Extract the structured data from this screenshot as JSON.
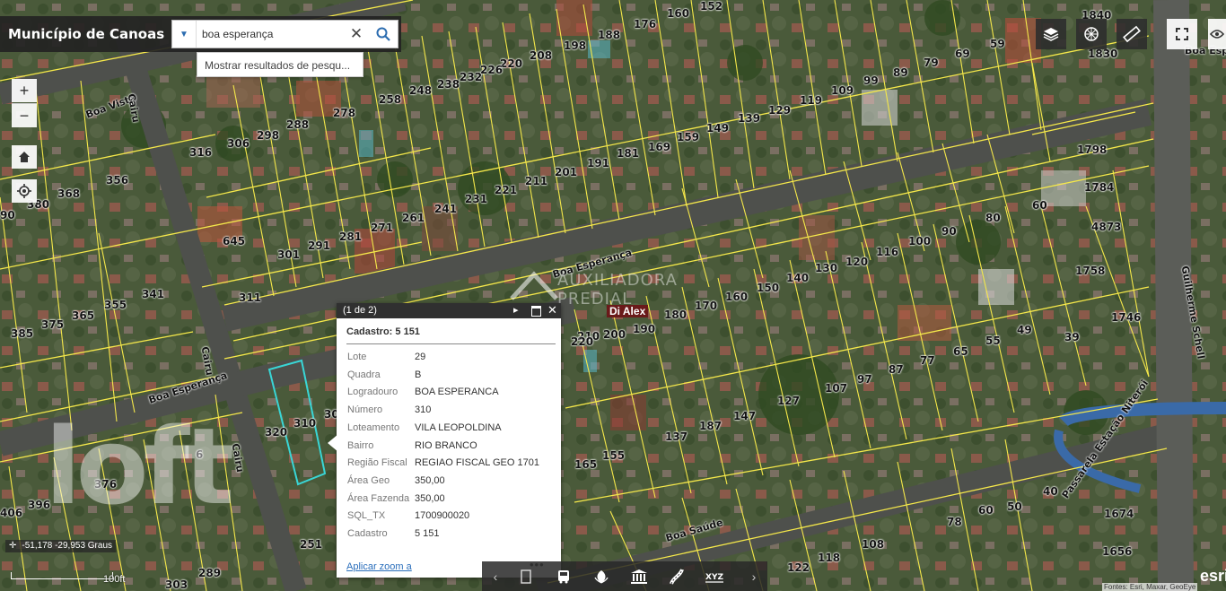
{
  "app": {
    "title": "Município de Canoas"
  },
  "search": {
    "value": "boa esperança",
    "suggestion": "Mostrar resultados de pesqu..."
  },
  "popup": {
    "count": "(1 de 2)",
    "title": "Cadastro: 5 151",
    "fields": [
      {
        "key": "Lote",
        "value": "29"
      },
      {
        "key": "Quadra",
        "value": "B"
      },
      {
        "key": "Logradouro",
        "value": "BOA ESPERANCA"
      },
      {
        "key": "Número",
        "value": "310"
      },
      {
        "key": "Loteamento",
        "value": "VILA LEOPOLDINA"
      },
      {
        "key": "Bairro",
        "value": "RIO BRANCO"
      },
      {
        "key": "Região Fiscal",
        "value": "REGIAO FISCAL GEO 1701"
      },
      {
        "key": "Área Geo",
        "value": "350,00"
      },
      {
        "key": "Área Fazenda",
        "value": "350,00"
      },
      {
        "key": "SQL_TX",
        "value": "1700900020"
      },
      {
        "key": "Cadastro",
        "value": "5 151"
      }
    ],
    "zoom_link": "Aplicar zoom a",
    "more": "•••"
  },
  "status": {
    "coordinates": "-51,178 -29,953 Graus",
    "scale": "100ft"
  },
  "streets": [
    "Boa Vista",
    "Cairu",
    "Boa Esperança",
    "Boa Esperança",
    "Cairu",
    "Boa Esperança",
    "Cairu",
    "Boa Saúde",
    "Guilherme Schell",
    "Passarela Estação Niterói"
  ],
  "parcels": [
    "176",
    "160",
    "152",
    "198",
    "188",
    "1840",
    "1830",
    "59",
    "89",
    "79",
    "69",
    "99",
    "109",
    "119",
    "129",
    "139",
    "149",
    "159",
    "169",
    "181",
    "191",
    "201",
    "211",
    "221",
    "231",
    "241",
    "261",
    "271",
    "281",
    "291",
    "301",
    "311",
    "208",
    "220",
    "226",
    "232",
    "238",
    "248",
    "258",
    "278",
    "288",
    "298",
    "306",
    "316",
    "356",
    "368",
    "380",
    "90",
    "645",
    "341",
    "355",
    "365",
    "375",
    "385",
    "1798",
    "1784",
    "4873",
    "1758",
    "1746",
    "60",
    "80",
    "90",
    "100",
    "116",
    "120",
    "130",
    "140",
    "150",
    "160",
    "170",
    "180",
    "190",
    "200",
    "210",
    "220",
    "39",
    "49",
    "55",
    "65",
    "77",
    "87",
    "97",
    "107",
    "127",
    "147",
    "137",
    "187",
    "155",
    "165",
    "40",
    "50",
    "60",
    "78",
    "108",
    "118",
    "122",
    "1674",
    "1656",
    "320",
    "310",
    "30",
    "251",
    "289",
    "303",
    "396",
    "406",
    "376",
    "6"
  ],
  "overlay": {
    "watermark_realestate": "AUXILIADORA PREDIAL",
    "watermark_brand": "loft",
    "sign": "Di Alex",
    "attribution": "Fontes: Esri, Maxar, GeoEye",
    "brand_corner": "esri"
  },
  "colors": {
    "parcel_line": "#f5e84a",
    "selected_parcel": "#39d6d6",
    "ui_dark": "#2d2d2d",
    "link": "#2a6ebb"
  },
  "icons": [
    "chevron-down-icon",
    "clear-icon",
    "search-icon",
    "zoom-in-icon",
    "zoom-out-icon",
    "home-icon",
    "locate-icon",
    "layers-icon",
    "basemap-icon",
    "measure-icon",
    "fullscreen-icon",
    "eye-icon",
    "maximize-icon",
    "close-icon",
    "pin-icon"
  ]
}
